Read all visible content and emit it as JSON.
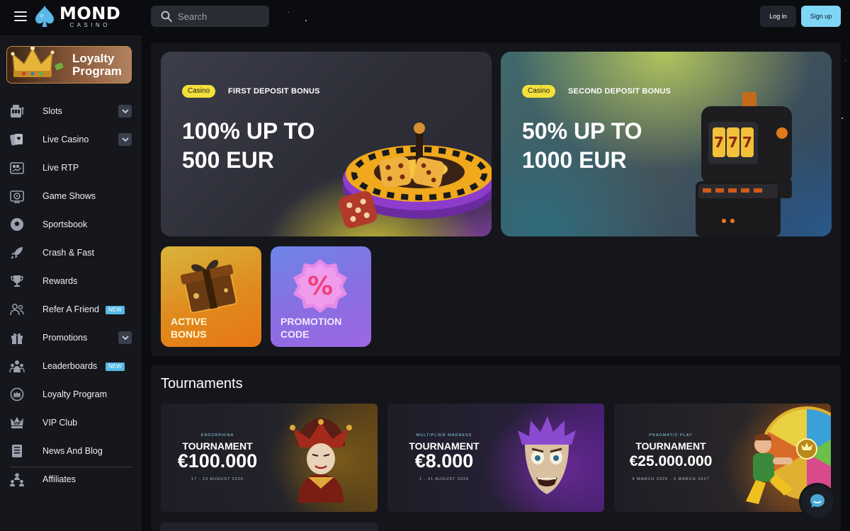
{
  "header": {
    "logo_main": "MOND",
    "logo_sub": "CASINO",
    "search_placeholder": "Search",
    "login_label": "Log in",
    "signup_label": "Sign up"
  },
  "sidebar": {
    "loyalty_card_label_line1": "Loyalty",
    "loyalty_card_label_line2": "Program",
    "items": [
      {
        "label": "Slots",
        "icon": "slot-machine-icon",
        "expandable": true
      },
      {
        "label": "Live Casino",
        "icon": "cards-icon",
        "expandable": true
      },
      {
        "label": "Live RTP",
        "icon": "rtp-icon"
      },
      {
        "label": "Game Shows",
        "icon": "game-show-icon"
      },
      {
        "label": "Sportsbook",
        "icon": "soccer-ball-icon"
      },
      {
        "label": "Crash & Fast",
        "icon": "rocket-icon"
      },
      {
        "label": "Rewards",
        "icon": "trophy-icon"
      },
      {
        "label": "Refer A Friend",
        "icon": "refer-friend-icon",
        "badge": "NEW"
      },
      {
        "label": "Promotions",
        "icon": "gift-icon",
        "expandable": true
      },
      {
        "label": "Leaderboards",
        "icon": "leaderboard-icon",
        "badge": "NEW"
      },
      {
        "label": "Loyalty Program",
        "icon": "loyalty-icon"
      },
      {
        "label": "VIP Club",
        "icon": "vip-crown-icon"
      },
      {
        "label": "News And Blog",
        "icon": "news-icon"
      },
      {
        "label": "Affiliates",
        "icon": "affiliates-icon"
      }
    ]
  },
  "banners": [
    {
      "tag": "Casino",
      "title": "FIRST DEPOSIT BONUS",
      "amount_line1": "100% UP TO",
      "amount_line2": "500 EUR"
    },
    {
      "tag": "Casino",
      "title": "SECOND DEPOSIT BONUS",
      "amount_line1": "50% UP TO",
      "amount_line2": "1000 EUR"
    }
  ],
  "tiles": [
    {
      "line1": "ACTIVE",
      "line2": "BONUS"
    },
    {
      "line1": "PROMOTION",
      "line2": "CODE"
    }
  ],
  "tournaments": {
    "heading": "Tournaments",
    "cards": [
      {
        "provider": "ENDORPHINA",
        "kind": "TOURNAMENT",
        "prize": "€100.000",
        "dates": "17 - 23 AUGUST 2026"
      },
      {
        "provider": "MULTIPLIER MADNESS",
        "kind": "TOURNAMENT",
        "prize": "€8.000",
        "dates": "1 - 31 AUGUST 2026"
      },
      {
        "provider": "PRAGMATIC PLAY",
        "kind": "TOURNAMENT",
        "prize": "€25.000.000",
        "dates": "4 MARCH 2026 - 3 MARCH 2027"
      }
    ]
  },
  "colors": {
    "accent_signup": "#7fd6f5",
    "tag_yellow": "#f4e03a",
    "badge_new": "#55b9e6",
    "background": "#0b0c10",
    "sidebar": "#16171c"
  }
}
